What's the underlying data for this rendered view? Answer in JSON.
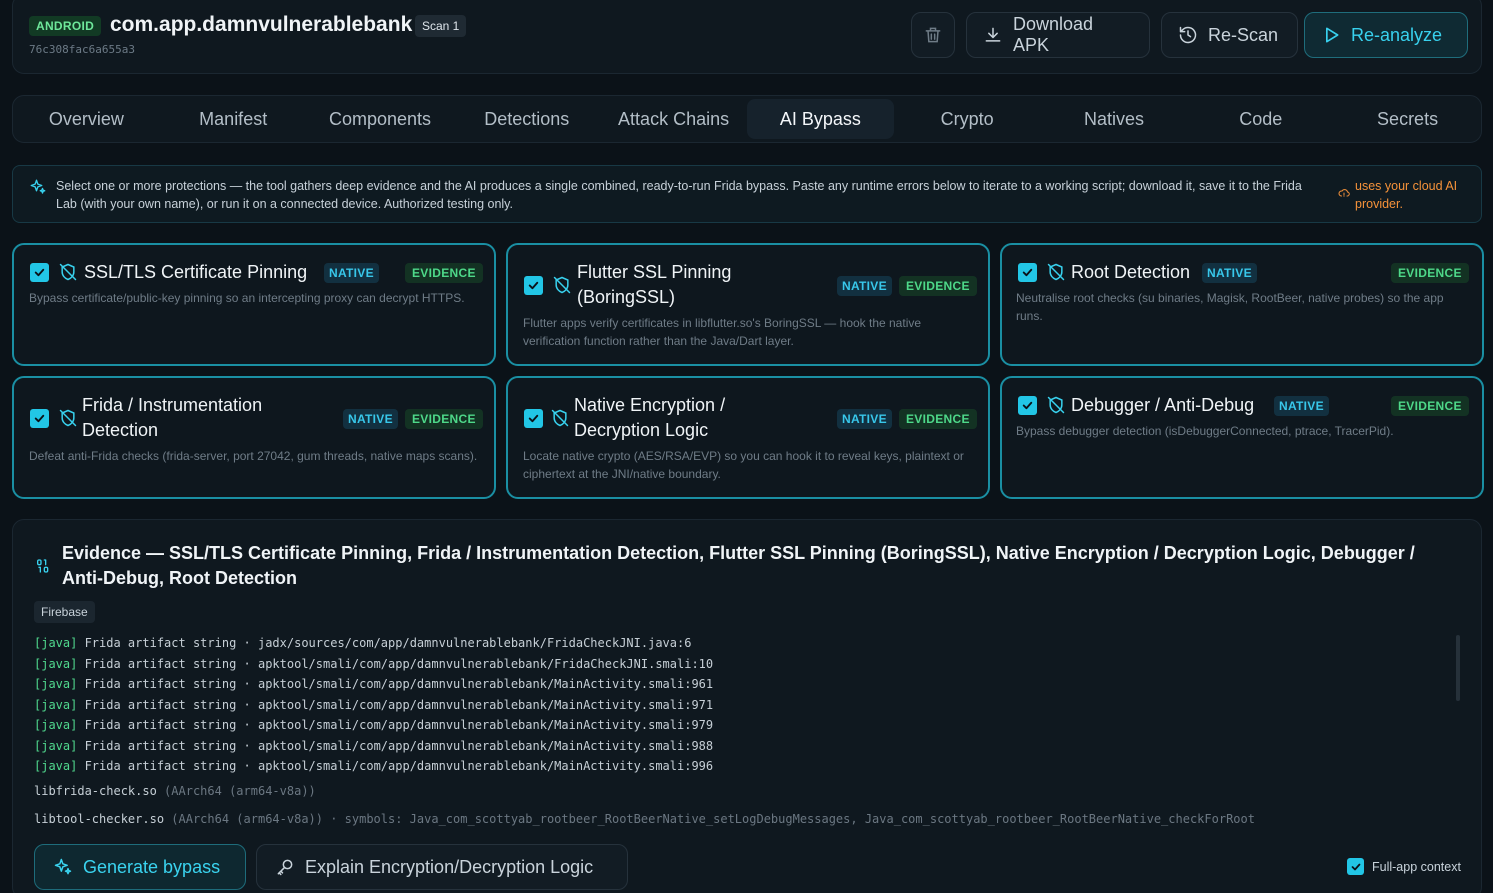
{
  "header": {
    "platform": "ANDROID",
    "package": "com.app.damnvulnerablebank",
    "scan_label": "Scan 1",
    "hash": "76c308fac6a655a3",
    "buttons": {
      "delete_icon": "trash-icon",
      "download": "Download APK",
      "rescan": "Re-Scan",
      "reanalyze": "Re-analyze"
    }
  },
  "tabs": [
    "Overview",
    "Manifest",
    "Components",
    "Detections",
    "Attack Chains",
    "AI Bypass",
    "Crypto",
    "Natives",
    "Code",
    "Secrets"
  ],
  "active_tab": "AI Bypass",
  "banner": {
    "text": "Select one or more protections — the tool gathers deep evidence and the AI produces a single combined, ready-to-run Frida bypass. Paste any runtime errors below to iterate to a working script; download it, save it to the Frida Lab (with your own name), or run it on a connected device. Authorized testing only.",
    "warning": "uses your cloud AI provider."
  },
  "badges": {
    "native": "NATIVE",
    "evidence": "EVIDENCE"
  },
  "protections": [
    {
      "title": "SSL/TLS Certificate Pinning",
      "desc": "Bypass certificate/public-key pinning so an intercepting proxy can decrypt HTTPS.",
      "checked": true
    },
    {
      "title": "Flutter SSL Pinning (BoringSSL)",
      "desc": "Flutter apps verify certificates in libflutter.so's BoringSSL — hook the native verification function rather than the Java/Dart layer.",
      "checked": true
    },
    {
      "title": "Root Detection",
      "desc": "Neutralise root checks (su binaries, Magisk, RootBeer, native probes) so the app runs.",
      "checked": true
    },
    {
      "title": "Frida / Instrumentation Detection",
      "desc": "Defeat anti-Frida checks (frida-server, port 27042, gum threads, native maps scans).",
      "checked": true
    },
    {
      "title": "Native Encryption / Decryption Logic",
      "desc": "Locate native crypto (AES/RSA/EVP) so you can hook it to reveal keys, plaintext or ciphertext at the JNI/native boundary.",
      "checked": true
    },
    {
      "title": "Debugger / Anti-Debug",
      "desc": "Bypass debugger detection (isDebuggerConnected, ptrace, TracerPid).",
      "checked": true
    }
  ],
  "evidence": {
    "title": "Evidence — SSL/TLS Certificate Pinning, Frida / Instrumentation Detection, Flutter SSL Pinning (BoringSSL), Native Encryption / Decryption Logic, Debugger / Anti-Debug, Root Detection",
    "chip": "Firebase",
    "lines": [
      {
        "tag": "[java]",
        "text": " Frida artifact string · jadx/sources/com/app/damnvulnerablebank/FridaCheckJNI.java:6"
      },
      {
        "tag": "[java]",
        "text": " Frida artifact string · apktool/smali/com/app/damnvulnerablebank/FridaCheckJNI.smali:10"
      },
      {
        "tag": "[java]",
        "text": " Frida artifact string · apktool/smali/com/app/damnvulnerablebank/MainActivity.smali:961"
      },
      {
        "tag": "[java]",
        "text": " Frida artifact string · apktool/smali/com/app/damnvulnerablebank/MainActivity.smali:971"
      },
      {
        "tag": "[java]",
        "text": " Frida artifact string · apktool/smali/com/app/damnvulnerablebank/MainActivity.smali:979"
      },
      {
        "tag": "[java]",
        "text": " Frida artifact string · apktool/smali/com/app/damnvulnerablebank/MainActivity.smali:988"
      },
      {
        "tag": "[java]",
        "text": " Frida artifact string · apktool/smali/com/app/damnvulnerablebank/MainActivity.smali:996"
      }
    ],
    "libs": [
      {
        "name": "libfrida-check.so",
        "meta": " (AArch64 (arm64-v8a))"
      },
      {
        "name": "libtool-checker.so",
        "meta": " (AArch64 (arm64-v8a)) · symbols: Java_com_scottyab_rootbeer_RootBeerNative_setLogDebugMessages, Java_com_scottyab_rootbeer_RootBeerNative_checkForRoot"
      }
    ],
    "generate": "Generate bypass",
    "explain": "Explain Encryption/Decryption Logic",
    "full_context": "Full-app context"
  },
  "colors": {
    "accent": "#22c6e6",
    "border": "#1a8fa3",
    "warning": "#f5923a",
    "evidence": "#4ed889"
  }
}
